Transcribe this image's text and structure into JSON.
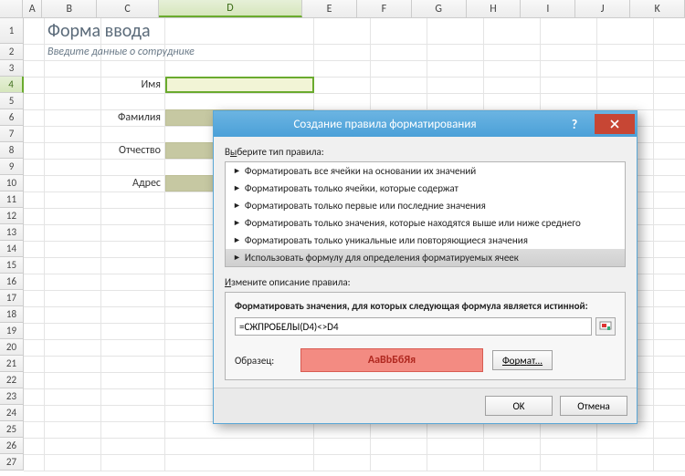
{
  "columns": [
    "A",
    "B",
    "C",
    "D",
    "E",
    "F",
    "G",
    "H",
    "I",
    "J",
    "K"
  ],
  "active_column": "D",
  "rows": [
    "1",
    "2",
    "3",
    "4",
    "5",
    "6",
    "7",
    "8",
    "9",
    "10",
    "11",
    "12",
    "13",
    "14",
    "15",
    "16",
    "17",
    "18",
    "19",
    "20",
    "21",
    "22",
    "23",
    "24",
    "25",
    "26",
    "27"
  ],
  "active_row": "4",
  "sheet": {
    "title": "Форма ввода",
    "subtitle": "Введите данные о сотруднике",
    "labels": {
      "name": "Имя",
      "surname": "Фамилия",
      "patronymic": "Отчество",
      "address": "Адрес"
    }
  },
  "dialog": {
    "title": "Создание правила форматирования",
    "help": "?",
    "select_label_pre": "В",
    "select_label_u": "ы",
    "select_label_post": "берите тип правила:",
    "rule_types": [
      "Форматировать все ячейки на основании их значений",
      "Форматировать только ячейки, которые содержат",
      "Форматировать только первые или последние значения",
      "Форматировать только значения, которые находятся выше или ниже среднего",
      "Форматировать только уникальные или повторяющиеся значения",
      "Использовать формулу для определения форматируемых ячеек"
    ],
    "selected_rule_index": 5,
    "edit_label_u": "И",
    "edit_label_post": "змените описание правила:",
    "formula_label": "Форматировать значения, для которых следующая формула является истинной:",
    "formula_value": "=СЖПРОБЕЛЫ(D4)<>D4",
    "sample_label": "Образец:",
    "sample_text": "АаВbБбЯя",
    "format_button_pre": "Фор",
    "format_button_u": "м",
    "format_button_post": "ат...",
    "ok": "OK",
    "cancel": "Отмена"
  }
}
